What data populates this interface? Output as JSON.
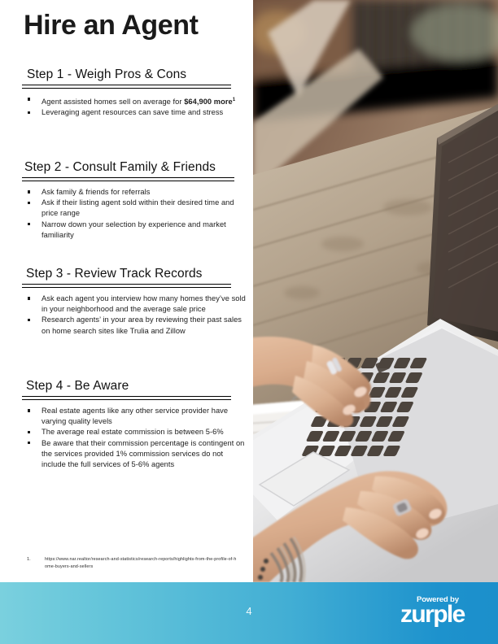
{
  "document": {
    "title": "Hire an Agent",
    "page_number": "4"
  },
  "sections": [
    {
      "heading": "Step 1 - Weigh Pros & Cons",
      "bullets": [
        "Agent assisted homes sell on average for $64,900 more",
        "Leveraging agent resources can save time and stress"
      ]
    },
    {
      "heading": "Step 2 - Consult Family & Friends",
      "bullets": [
        "Ask family & friends for referrals",
        "Ask if their listing agent sold within their desired time and price range",
        "Narrow down your selection by experience and market familiarity"
      ]
    },
    {
      "heading": "Step 3 - Review Track Records",
      "bullets": [
        "Ask each agent you interview how many homes they’ve sold in your neighborhood and the average sale price",
        "Research agents’ in your area by reviewing their past sales on home search sites like Trulia and Zillow"
      ]
    },
    {
      "heading": "Step 4 - Be Aware",
      "bullets": [
        "Real estate agents like any other service provider have varying quality levels",
        "The average real estate commission is between 5-6%",
        "Be aware that their commission percentage is contingent on the services provided  1% commission services do not include the full services of 5-6% agents"
      ]
    }
  ],
  "footnote": {
    "number": "1.",
    "url": "https://www.nar.realtor/research-and-statistics/research-reports/highlights-from-the-profile-of-home-buyers-and-sellers"
  },
  "footer": {
    "powered_by": "Powered by",
    "brand": "zurple"
  },
  "photo": {
    "description": "woman typing on white laptop at wooden deck table with spiral notebook and pen"
  },
  "colors": {
    "footer_gradient_start": "#7ad0de",
    "footer_gradient_end": "#1c8fcb",
    "text": "#1c1c1c",
    "rule": "#000000"
  }
}
